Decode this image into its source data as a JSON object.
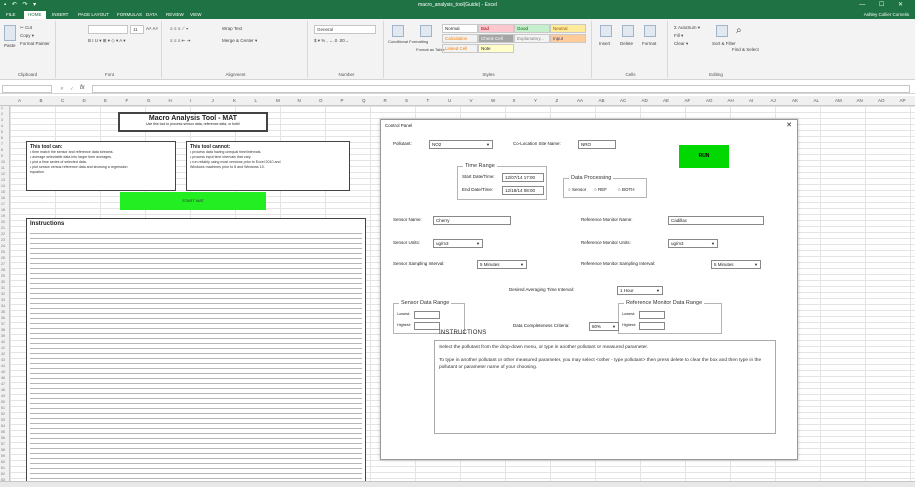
{
  "window": {
    "title": "macro_analysis_tool(Guide) - Excel",
    "user": "Ashley Collier Cornelis",
    "quick_access": "▪ ↶ ↷ ▾",
    "controls": "— ☐ ✕"
  },
  "ribbon_tabs": [
    "FILE",
    "HOME",
    "INSERT",
    "PAGE LAYOUT",
    "FORMULAS",
    "DATA",
    "REVIEW",
    "VIEW"
  ],
  "ribbon": {
    "clipboard": {
      "label": "Clipboard",
      "paste": "Paste",
      "cut": "✂ Cut",
      "copy": "Copy ▾",
      "painter": "Format Painter"
    },
    "font": {
      "label": "Font",
      "name": "",
      "size": "11",
      "controls": "B  I  U  ▾  ⊞ ▾  ◇ ▾  A ▾",
      "grow": "A˄ A˅"
    },
    "alignment": {
      "label": "Alignment",
      "wrap": "Wrap Text",
      "merge": "Merge & Center ▾"
    },
    "number": {
      "label": "Number",
      "format": "General",
      "symbols": "$ ▾ % ,  ←.0 .00→"
    },
    "styles": {
      "label": "Styles",
      "conditional": "Conditional Formatting",
      "table": "Format as Table",
      "cells": [
        "Normal",
        "Bad",
        "Good",
        "Neutral",
        "Calculation",
        "Check Cell",
        "Explanatory...",
        "Input",
        "Linked Cell",
        "Note"
      ]
    },
    "cells": {
      "label": "Cells",
      "insert": "Insert",
      "delete": "Delete",
      "format": "Format"
    },
    "editing": {
      "label": "Editing",
      "autosum": "Σ AutoSum ▾",
      "fill": "Fill ▾",
      "clear": "Clear ▾",
      "sort": "Sort & Filter",
      "find": "Find & Select"
    }
  },
  "formula_bar": {
    "name_box": "",
    "fx": "fx",
    "cancel": "✕",
    "enter": "✓"
  },
  "columns": [
    "A",
    "B",
    "C",
    "D",
    "E",
    "F",
    "G",
    "H",
    "I",
    "J",
    "K",
    "L",
    "M",
    "N",
    "O",
    "P",
    "Q",
    "R",
    "S",
    "T",
    "U",
    "V",
    "W",
    "X",
    "Y",
    "Z",
    "AA",
    "AB",
    "AC",
    "AD",
    "AE",
    "AF",
    "AG",
    "AH",
    "AI",
    "AJ",
    "AK",
    "AL",
    "AM",
    "AN",
    "AO",
    "AP"
  ],
  "sheet": {
    "title": "Macro Analysis Tool - MAT",
    "subtitle": "Use this tool to process sensor data, reference data, or both!",
    "can_title": "This tool can:",
    "can_items": [
      "• time match the sensor and reference data streams.",
      "• average selectable data into larger time averages.",
      "• plot a time series of selected data.",
      "• plot sensor versus reference data and showing a regression",
      "   equation."
    ],
    "cannot_title": "This tool cannot:",
    "cannot_items": [
      "• process data having unequal time/intervals.",
      "• process input time intervals that vary.",
      "• run reliably using most versions prior to Excel 2010 and",
      "   Windows machines prior to 8 and Windows 10."
    ],
    "run_button": "START MAT",
    "instructions_title": "Instructions"
  },
  "dialog": {
    "title": "Control Panel",
    "close": "✕",
    "pollutant_label": "Pollutant:",
    "pollutant_value": "NO2",
    "colocation_label": "Co-Location Site Name:",
    "colocation_value": "NRO",
    "run_label": "RUN",
    "time_range": {
      "title": "Time Range",
      "start_label": "Start Date/Time:",
      "start_value": "12/07/14 17:00",
      "end_label": "End Date/Time:",
      "end_value": "12/18/14 08:00"
    },
    "data_processing": {
      "title": "Data Processing",
      "options": [
        "Sensor",
        "REF",
        "BOTH"
      ]
    },
    "sensor_name_label": "Sensor Name:",
    "sensor_name_value": "Cherry",
    "ref_name_label": "Reference Monitor Name:",
    "ref_name_value": "Cadillac",
    "sensor_units_label": "Sensor Units:",
    "sensor_units_value": "ug/m3",
    "ref_units_label": "Reference Monitor Units:",
    "ref_units_value": "ug/m3",
    "sensor_interval_label": "Sensor Sampling Interval:",
    "sensor_interval_value": "5 Minutes",
    "ref_interval_label": "Reference Monitor Sampling Interval:",
    "ref_interval_value": "5 Minutes",
    "avg_label": "Desired Averaging Time Interval:",
    "avg_value": "1 Hour",
    "sensor_range": {
      "title": "Sensor Data Range",
      "lower": "Lowest:",
      "upper": "Highest:"
    },
    "ref_range": {
      "title": "Reference Monitor Data Range",
      "lower": "Lowest:",
      "upper": "Highest:"
    },
    "completeness_label": "Data Completeness Criteria:",
    "completeness_value": "80%",
    "instructions_heading": "INSTRUCTIONS",
    "instructions_p1": "Select the pollutant from the drop-down menu, or type in another pollutant or measured parameter.",
    "instructions_p2": "To type in another pollutant or other measured parameter, you may select <other - type pollutant> then press delete to clear the box and then type in the pollutant or parameter name of your choosing."
  }
}
